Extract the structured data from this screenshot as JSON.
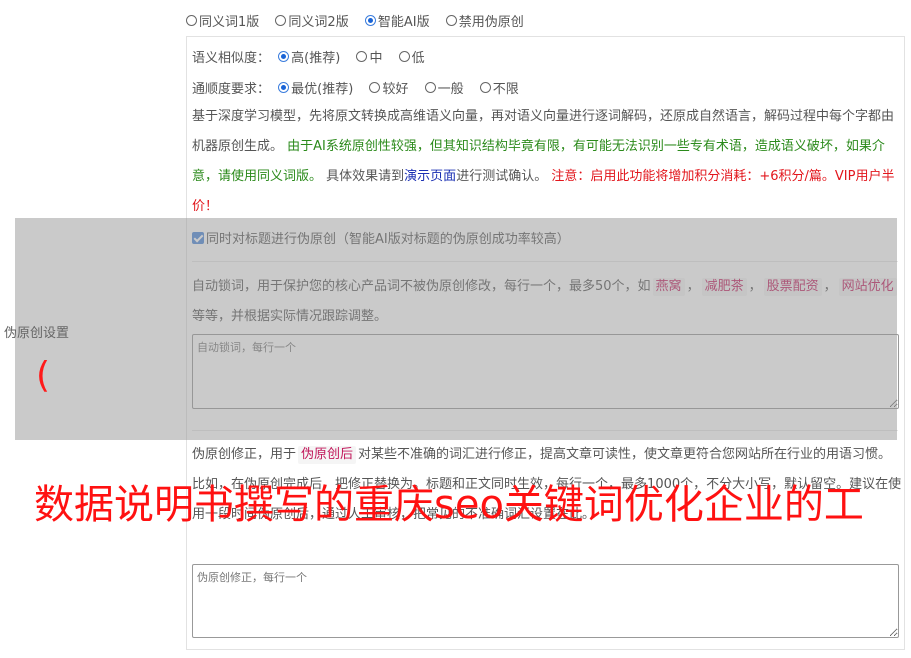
{
  "top_options": [
    {
      "label": "同义词1版",
      "checked": false
    },
    {
      "label": "同义词2版",
      "checked": false
    },
    {
      "label": "智能AI版",
      "checked": true
    },
    {
      "label": "禁用伪原创",
      "checked": false
    }
  ],
  "similarity": {
    "label": "语义相似度：",
    "options": [
      {
        "label": "高(推荐)",
        "checked": true
      },
      {
        "label": "中",
        "checked": false
      },
      {
        "label": "低",
        "checked": false
      }
    ]
  },
  "fluency": {
    "label": "通顺度要求：",
    "options": [
      {
        "label": "最优(推荐)",
        "checked": true
      },
      {
        "label": "较好",
        "checked": false
      },
      {
        "label": "一般",
        "checked": false
      },
      {
        "label": "不限",
        "checked": false
      }
    ]
  },
  "description": {
    "p1": "基于深度学习模型，先将原文转换成高维语义向量，再对语义向量进行逐词解码，还原成自然语言，解码过程中每个字都由机器原创生成。",
    "p2_green": "由于AI系统原创性较强，但其知识结构毕竟有限，有可能无法识别一些专有术语，造成语义破坏，如果介意，请使用同义词版。",
    "p3": "具体效果请到",
    "p3_link": "演示页面",
    "p3_tail": "进行测试确认。",
    "p4_red": "注意：启用此功能将增加积分消耗：+6积分/篇。VIP用户半价！"
  },
  "title_checkbox": {
    "label": "同时对标题进行伪原创（智能AI版对标题的伪原创成功率较高）",
    "checked": true
  },
  "lock_words": {
    "text1": "自动锁词，用于保护您的核心产品词不被伪原创修改，每行一个，最多50个，如",
    "tags": [
      "燕窝",
      "减肥茶",
      "股票配资",
      "网站优化"
    ],
    "sep": "，",
    "text2": "等等，并根据实际情况跟踪调整。",
    "placeholder": "自动锁词，每行一个"
  },
  "side_label": "伪原创设置",
  "paren": "(",
  "correction": {
    "text1": "伪原创修正，用于",
    "tag": "伪原创后",
    "text2": "对某些不准确的词汇进行修正，提高文章可读性，使文章更符合您网站所在行业的用语习惯。比如",
    "text3": "，在伪原创完成后，把",
    "text4": "修正替换为",
    "text5": "。标题和正文同时生效，每行一个，最多1000个，不分大小写，默认留空。建议在使用一段时间伪原创后，通过人工审核，把常见的不准确词汇设置在此。",
    "placeholder": "伪原创修正，每行一个"
  },
  "watermark": "数据说明书撰写的重庆seo关键词优化企业的工"
}
